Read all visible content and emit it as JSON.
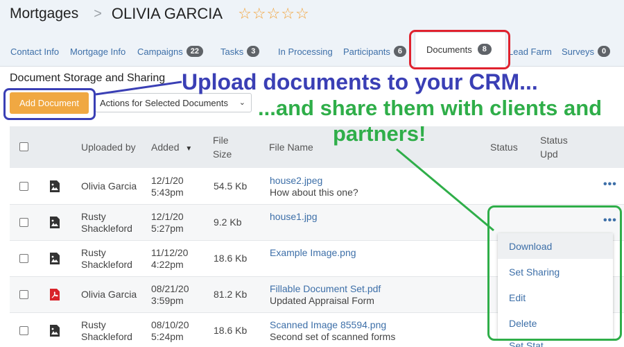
{
  "header": {
    "section": "Mortgages",
    "separator": ">",
    "contact_name": "OLIVIA GARCIA",
    "rating_stars": 5,
    "rating_filled": 0
  },
  "tabs": [
    {
      "label": "Contact Info",
      "badge": null
    },
    {
      "label": "Mortgage Info",
      "badge": null
    },
    {
      "label": "Campaigns",
      "badge": "22"
    },
    {
      "label": "Tasks",
      "badge": "3"
    },
    {
      "label": "In Processing",
      "badge": null
    },
    {
      "label": "Participants",
      "badge": "6"
    },
    {
      "label": "Documents",
      "badge": "8",
      "active": true
    },
    {
      "label": "Lead Farm",
      "badge": null
    },
    {
      "label": "Surveys",
      "badge": "0"
    }
  ],
  "documents": {
    "title": "Document Storage and Sharing",
    "add_button": "Add Document",
    "actions_select": "Actions for Selected Documents",
    "columns": {
      "uploaded_by": "Uploaded by",
      "added": "Added",
      "file_size_1": "File",
      "file_size_2": "Size",
      "file_name": "File Name",
      "status": "Status",
      "status_upd_1": "Status",
      "status_upd_2": "Upd"
    },
    "rows": [
      {
        "icon": "image-file-icon",
        "uploader_1": "Olivia Garcia",
        "uploader_2": "",
        "date": "12/1/20",
        "time": "5:43pm",
        "size": "54.5 Kb",
        "file": "house2.jpeg",
        "desc": "How about this one?"
      },
      {
        "icon": "image-file-icon",
        "uploader_1": "Rusty",
        "uploader_2": "Shackleford",
        "date": "12/1/20",
        "time": "5:27pm",
        "size": "9.2 Kb",
        "file": "house1.jpg",
        "desc": ""
      },
      {
        "icon": "image-file-icon",
        "uploader_1": "Rusty",
        "uploader_2": "Shackleford",
        "date": "11/12/20",
        "time": "4:22pm",
        "size": "18.6 Kb",
        "file": "Example Image.png",
        "desc": ""
      },
      {
        "icon": "pdf-file-icon",
        "uploader_1": "Olivia Garcia",
        "uploader_2": "",
        "date": "08/21/20",
        "time": "3:59pm",
        "size": "81.2 Kb",
        "file": "Fillable Document Set.pdf",
        "desc": "Updated Appraisal Form"
      },
      {
        "icon": "image-file-icon",
        "uploader_1": "Rusty",
        "uploader_2": "Shackleford",
        "date": "08/10/20",
        "time": "5:24pm",
        "size": "18.6 Kb",
        "file": "Scanned Image 85594.png",
        "desc": "Second set of scanned forms"
      }
    ],
    "row_menu_symbol": "•••",
    "menu": [
      "Download",
      "Set Sharing",
      "Edit",
      "Delete"
    ],
    "menu_peek": "Set Stat"
  },
  "annotations": {
    "upload": "Upload documents to your CRM...",
    "share_1": "...and share them with clients and",
    "share_2": "partners!"
  },
  "colors": {
    "accent_link": "#3d6fa8",
    "add_button": "#f0a842",
    "star": "#f2a33a",
    "annotation_red": "#e0222e",
    "annotation_blue": "#3a3fb5",
    "annotation_green": "#2fae49"
  }
}
